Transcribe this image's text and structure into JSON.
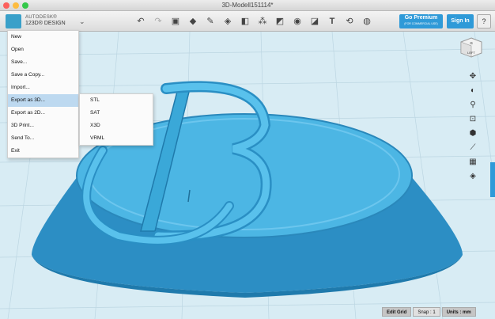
{
  "window": {
    "title": "3D-Modell151114*"
  },
  "brand": {
    "line1": "AUTODESK®",
    "line2": "123D® DESIGN"
  },
  "toolbar": {
    "icons": [
      "undo-icon",
      "redo-icon",
      "new-object-icon",
      "primitives-icon",
      "sketch-icon",
      "construct-icon",
      "modify-icon",
      "pattern-icon",
      "grouping-icon",
      "combine-icon",
      "measure-icon",
      "text-icon",
      "snap-icon",
      "material-icon"
    ],
    "premium_label": "Go Premium",
    "premium_sub": "(FOR COMMERCIAL USE)",
    "signin_label": "Sign In",
    "help_label": "?"
  },
  "menu": {
    "items": [
      "New",
      "Open",
      "Save...",
      "Save a Copy...",
      "Import...",
      "Export as 3D...",
      "Export as 2D...",
      "3D Print...",
      "Send To...",
      "Exit"
    ],
    "highlighted": "Export as 3D...",
    "submenu": [
      "STL",
      "SAT",
      "X3D",
      "VRML"
    ]
  },
  "viewcube": {
    "label": "LEFT"
  },
  "navbar": {
    "icons": [
      "pan-icon",
      "orbit-icon",
      "zoom-icon",
      "fit-icon",
      "view-icon",
      "visibility-icon",
      "grid-icon",
      "material-view-icon"
    ]
  },
  "status": {
    "edit_grid": "Edit Grid",
    "snap": "Snap : 1",
    "units": "Units : mm"
  },
  "colors": {
    "model": "#3aa8d8",
    "accent": "#2f9ad8",
    "grid_bg": "#d8ecf4"
  }
}
